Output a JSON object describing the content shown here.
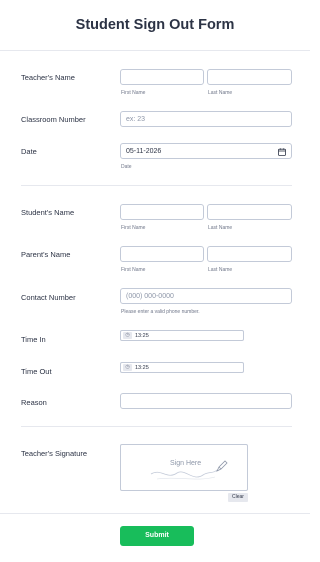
{
  "form": {
    "title": "Student Sign Out Form"
  },
  "teacher_name": {
    "label": "Teacher's Name",
    "first_sublabel": "First Name",
    "last_sublabel": "Last Name"
  },
  "classroom_number": {
    "label": "Classroom Number",
    "placeholder": "ex: 23"
  },
  "date": {
    "label": "Date",
    "value": "05-11-2026",
    "sublabel": "Date",
    "icon": "calendar-icon"
  },
  "student_name": {
    "label": "Student's Name",
    "first_sublabel": "First Name",
    "last_sublabel": "Last Name"
  },
  "parent_name": {
    "label": "Parent's Name",
    "first_sublabel": "First Name",
    "last_sublabel": "Last Name"
  },
  "contact_number": {
    "label": "Contact Number",
    "placeholder": "(000) 000-0000",
    "sublabel": "Please enter a valid phone number."
  },
  "time_in": {
    "label": "Time In",
    "value": "13:25",
    "icon": "clock-icon"
  },
  "time_out": {
    "label": "Time Out",
    "value": "13:25",
    "icon": "clock-icon"
  },
  "reason": {
    "label": "Reason"
  },
  "signature": {
    "label": "Teacher's Signature",
    "placeholder": "Sign Here",
    "clear_label": "Clear",
    "icon": "pen-icon"
  },
  "submit": {
    "label": "Submit",
    "color": "#18bd5b"
  }
}
